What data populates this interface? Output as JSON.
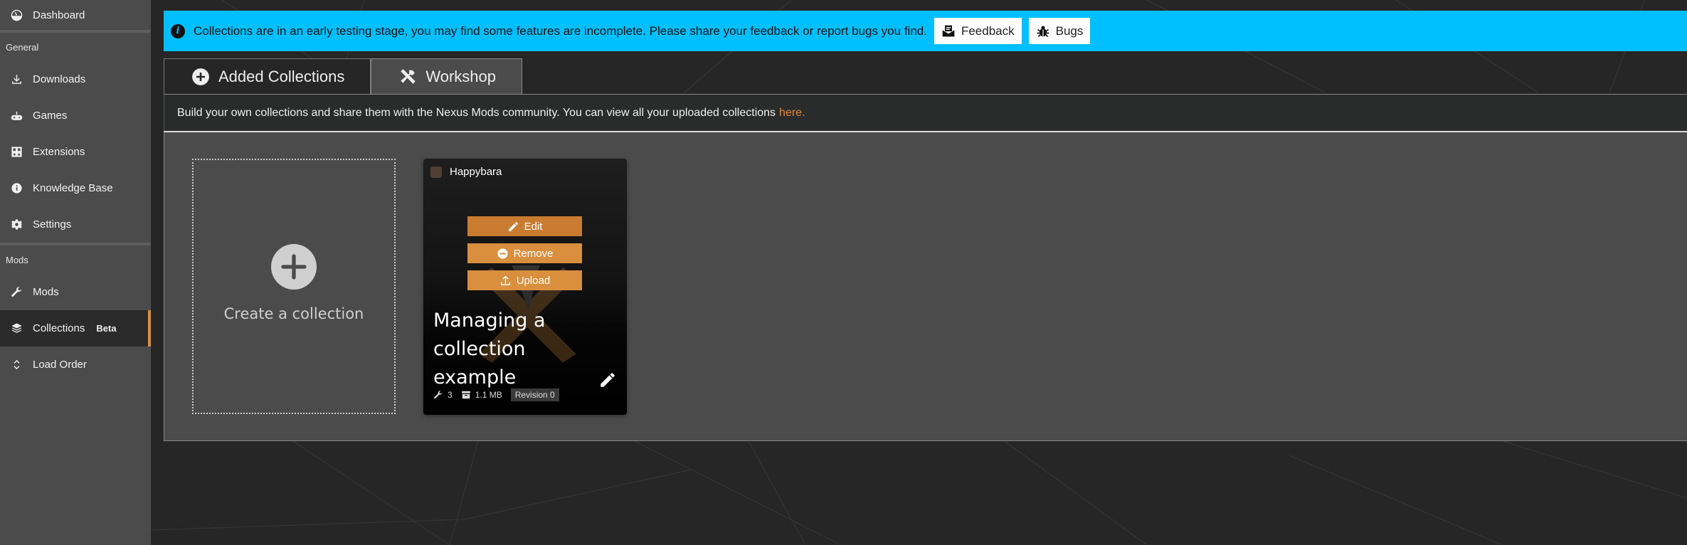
{
  "sidebar": {
    "top_item": {
      "label": "Dashboard",
      "icon": "dashboard-icon"
    },
    "sections": [
      {
        "header": "General",
        "items": [
          {
            "label": "Downloads",
            "icon": "download-icon"
          },
          {
            "label": "Games",
            "icon": "gamepad-icon"
          },
          {
            "label": "Extensions",
            "icon": "extensions-icon"
          },
          {
            "label": "Knowledge Base",
            "icon": "info-icon"
          },
          {
            "label": "Settings",
            "icon": "gear-icon"
          }
        ]
      },
      {
        "header": "Mods",
        "items": [
          {
            "label": "Mods",
            "icon": "wrench-icon"
          },
          {
            "label": "Collections",
            "icon": "layers-icon",
            "badge": "Beta",
            "active": true
          },
          {
            "label": "Load Order",
            "icon": "sort-icon"
          }
        ]
      }
    ],
    "accent_color": "#d98f3e"
  },
  "banner": {
    "text": "Collections are in an early testing stage, you may find some features are incomplete. Please share your feedback or report bugs you find.",
    "feedback_label": "Feedback",
    "bugs_label": "Bugs",
    "color": "#00bfff"
  },
  "tabs": [
    {
      "label": "Added Collections",
      "icon": "plus-circle-icon",
      "active": false
    },
    {
      "label": "Workshop",
      "icon": "tools-icon",
      "active": true
    }
  ],
  "description": {
    "text": "Build your own collections and share them with the Nexus Mods community. You can view all your uploaded collections",
    "link_label": "here."
  },
  "create_tile": {
    "label": "Create a collection"
  },
  "collection_card": {
    "author": "Happybara",
    "actions": [
      {
        "label": "Edit",
        "icon": "pencil-icon"
      },
      {
        "label": "Remove",
        "icon": "minus-circle-icon"
      },
      {
        "label": "Upload",
        "icon": "upload-icon"
      }
    ],
    "title": "Managing a collection example",
    "mod_count": "3",
    "size": "1.1 MB",
    "revision": "Revision 0"
  }
}
